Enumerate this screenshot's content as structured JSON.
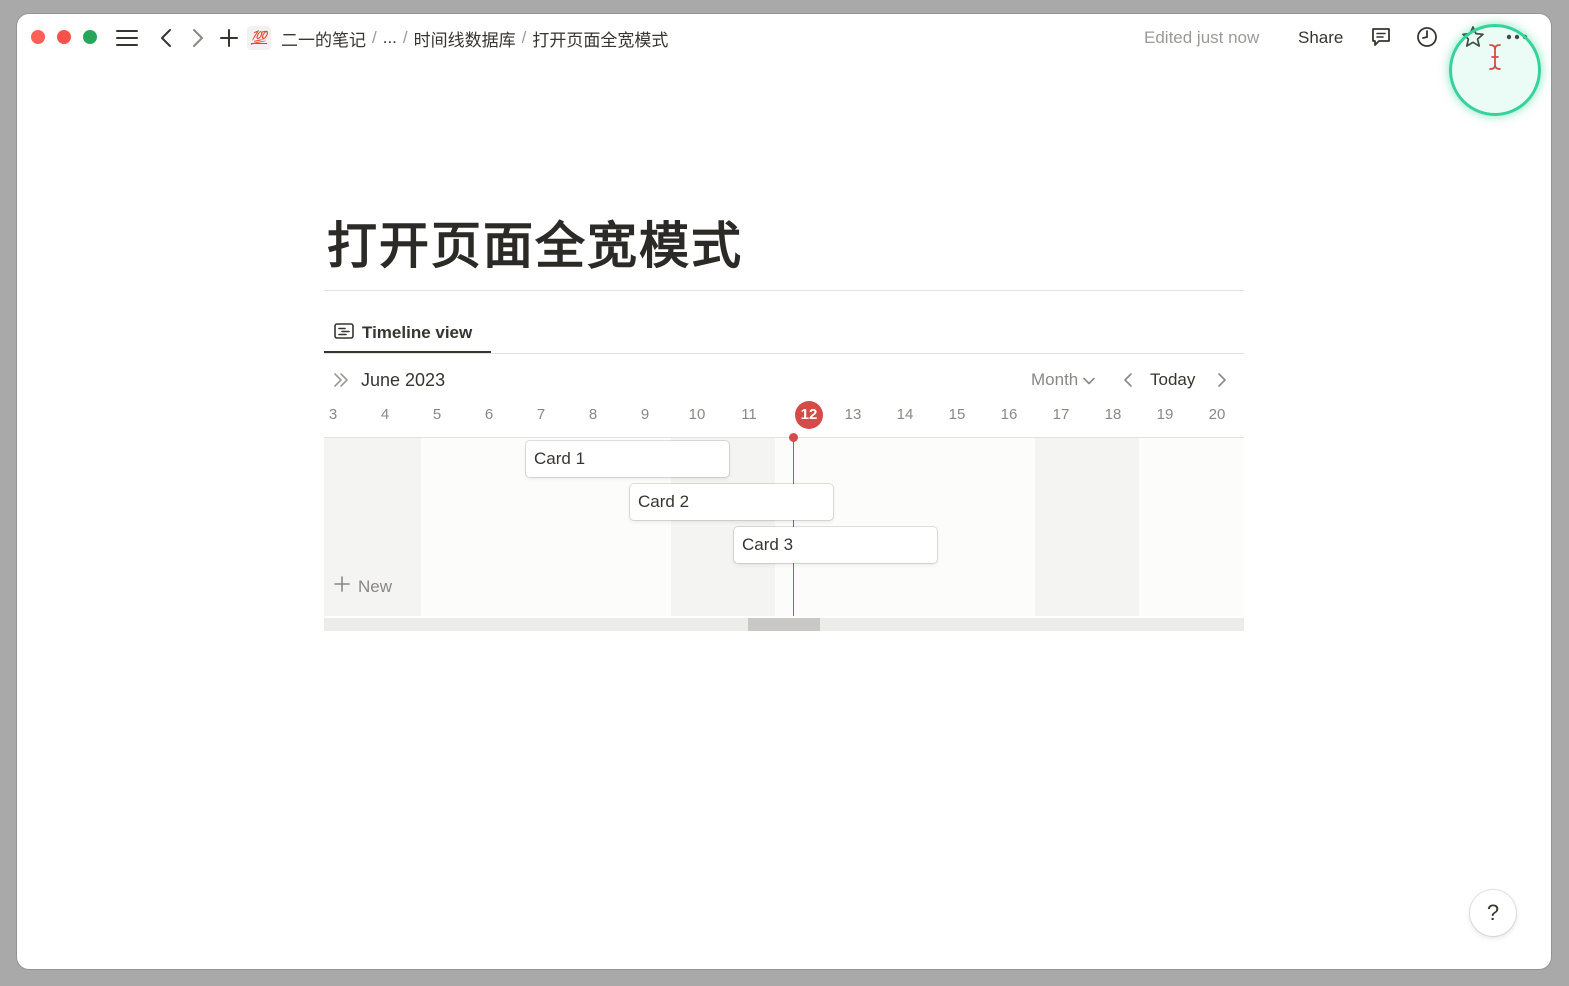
{
  "topbar": {
    "workspace_emoji": "💯",
    "breadcrumb": [
      {
        "label": "二一的笔记"
      },
      {
        "label": "..."
      },
      {
        "label": "时间线数据库"
      },
      {
        "label": "打开页面全宽模式"
      }
    ],
    "edited_text": "Edited just now",
    "share_label": "Share"
  },
  "page": {
    "title": "打开页面全宽模式",
    "view_tab_label": "Timeline view"
  },
  "timeline": {
    "month_label": "June 2023",
    "scale_label": "Month",
    "today_label": "Today",
    "today_date": 12,
    "days": [
      3,
      4,
      5,
      6,
      7,
      8,
      9,
      10,
      11,
      12,
      13,
      14,
      15,
      16,
      17,
      18,
      19,
      20
    ],
    "weekends": [
      [
        10,
        11
      ],
      [
        17,
        18
      ]
    ],
    "cards": [
      {
        "label": "Card 1",
        "start": 7,
        "end": 10
      },
      {
        "label": "Card 2",
        "start": 9,
        "end": 12
      },
      {
        "label": "Card 3",
        "start": 11,
        "end": 14
      }
    ],
    "new_label": "New"
  },
  "help_label": "?",
  "colors": {
    "accent_today": "#d44c47",
    "text": "#37352f",
    "muted": "#9b9a97"
  }
}
